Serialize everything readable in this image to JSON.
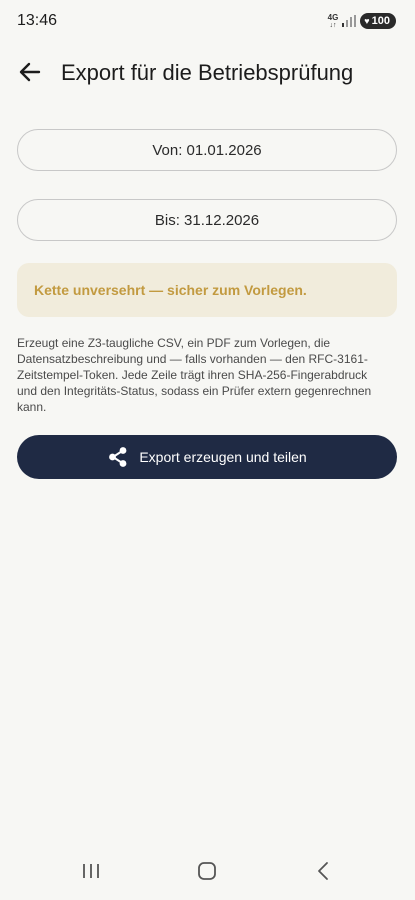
{
  "status_bar": {
    "time": "13:46",
    "network": "4G",
    "network_arrows": "↓↑",
    "battery": "100"
  },
  "app_bar": {
    "title": "Export für die Betriebsprüfung",
    "back_icon": "arrow-back-icon"
  },
  "date_range": {
    "from_label": "Von: 01.01.2026",
    "to_label": "Bis: 31.12.2026"
  },
  "chain_status": {
    "text": "Kette unversehrt — sicher zum Vorlegen.",
    "color": "#c29a40",
    "background": "#f1ecdc"
  },
  "description": "Erzeugt eine Z3-taugliche CSV, ein PDF zum Vorlegen, die Datensatzbeschreibung und — falls vorhanden — den RFC-3161-Zeitstempel-Token. Jede Zeile trägt ihren SHA-256-Fingerabdruck und den Integritäts-Status, sodass ein Prüfer extern gegenrechnen kann.",
  "export_button": {
    "label": "Export erzeugen und teilen",
    "icon": "share-icon",
    "color": "#1f2a44"
  },
  "nav_bar": {
    "recents_icon": "recents-icon",
    "home_icon": "home-icon",
    "back_icon": "nav-back-icon"
  }
}
